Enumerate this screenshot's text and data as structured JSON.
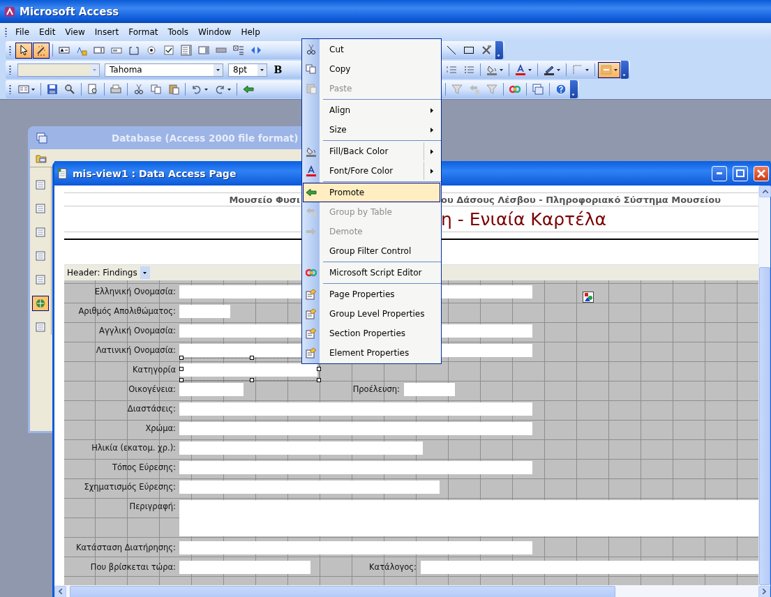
{
  "app_title": "Microsoft Access",
  "menu_bar": [
    "File",
    "Edit",
    "View",
    "Insert",
    "Format",
    "Tools",
    "Window",
    "Help"
  ],
  "toolbox": {
    "pointer_on": true,
    "wizards_on": true
  },
  "formatting": {
    "font": "Tahoma",
    "size": "8pt",
    "bold": "B",
    "special_effect_on": true
  },
  "database_window": {
    "title": "Database (Access 2000 file format)",
    "objects": [
      {
        "selected": false
      },
      {
        "selected": false
      },
      {
        "selected": false
      },
      {
        "selected": false
      },
      {
        "selected": false
      },
      {
        "selected": true
      },
      {
        "selected": false
      }
    ]
  },
  "page_window": {
    "title": "mis-view1 : Data Access Page",
    "header_left": "Μουσείο Φυσι",
    "header_right": "ου Δάσους Λέσβου - Πληροφοριακό Σύστημα Μουσείου",
    "heading": "η - Ενιαία Καρτέλα",
    "section": "Header: Findings",
    "fields": [
      {
        "label": "Ελληνική Ονομασία:",
        "selected": false,
        "multiline": false
      },
      {
        "label": "Αριθμός Απολιθώματος:",
        "selected": false,
        "multiline": false
      },
      {
        "label": "Αγγλική Ονομασία:",
        "selected": false,
        "multiline": false
      },
      {
        "label": "Λατινική Ονομασία:",
        "selected": false,
        "multiline": false
      },
      {
        "label": "Κατηγορία",
        "selected": true,
        "multiline": false
      },
      {
        "label": "Οικογένεια:",
        "selected": false,
        "multiline": false,
        "extra_label": "Προέλευση:"
      },
      {
        "label": "Διαστάσεις:",
        "selected": false,
        "multiline": false
      },
      {
        "label": "Χρώμα:",
        "selected": false,
        "multiline": false
      },
      {
        "label": "Ηλικία (εκατομ. χρ.):",
        "selected": false,
        "multiline": false
      },
      {
        "label": "Τόπος Εύρεσης:",
        "selected": false,
        "multiline": false
      },
      {
        "label": "Σχηματισμός Εύρεσης:",
        "selected": false,
        "multiline": false
      },
      {
        "label": "Περιγραφή:",
        "selected": false,
        "multiline": true
      },
      {
        "label": "Κατάσταση Διατήρησης:",
        "selected": false,
        "multiline": false
      },
      {
        "label": "Που βρίσκεται τώρα:",
        "selected": false,
        "multiline": false,
        "extra_label": "Κατάλογος:"
      }
    ]
  },
  "context_menu": [
    {
      "kind": "item",
      "label": "Cut",
      "disabled": false,
      "highlighted": false,
      "submenu": false
    },
    {
      "kind": "item",
      "label": "Copy",
      "disabled": false,
      "highlighted": false,
      "submenu": false
    },
    {
      "kind": "item",
      "label": "Paste",
      "disabled": true,
      "highlighted": false,
      "submenu": false
    },
    {
      "kind": "separator"
    },
    {
      "kind": "item",
      "label": "Align",
      "disabled": false,
      "highlighted": false,
      "submenu": true
    },
    {
      "kind": "item",
      "label": "Size",
      "disabled": false,
      "highlighted": false,
      "submenu": true
    },
    {
      "kind": "separator"
    },
    {
      "kind": "item",
      "label": "Fill/Back Color",
      "disabled": false,
      "highlighted": false,
      "submenu": true
    },
    {
      "kind": "item",
      "label": "Font/Fore Color",
      "disabled": false,
      "highlighted": false,
      "submenu": true
    },
    {
      "kind": "separator"
    },
    {
      "kind": "item",
      "label": "Promote",
      "disabled": false,
      "highlighted": true,
      "submenu": false
    },
    {
      "kind": "item",
      "label": "Group by Table",
      "disabled": true,
      "highlighted": false,
      "submenu": false
    },
    {
      "kind": "item",
      "label": "Demote",
      "disabled": true,
      "highlighted": false,
      "submenu": false
    },
    {
      "kind": "item",
      "label": "Group Filter Control",
      "disabled": false,
      "highlighted": false,
      "submenu": false
    },
    {
      "kind": "separator"
    },
    {
      "kind": "item",
      "label": "Microsoft Script Editor",
      "disabled": false,
      "highlighted": false,
      "submenu": false
    },
    {
      "kind": "separator"
    },
    {
      "kind": "item",
      "label": "Page Properties",
      "disabled": false,
      "highlighted": false,
      "submenu": false
    },
    {
      "kind": "item",
      "label": "Group Level Properties",
      "disabled": false,
      "highlighted": false,
      "submenu": false
    },
    {
      "kind": "item",
      "label": "Section Properties",
      "disabled": false,
      "highlighted": false,
      "submenu": false
    },
    {
      "kind": "item",
      "label": "Element Properties",
      "disabled": false,
      "highlighted": false,
      "submenu": false
    }
  ]
}
